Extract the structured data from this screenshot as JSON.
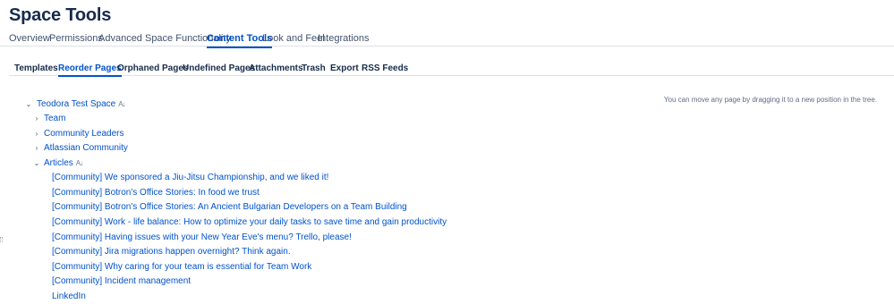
{
  "page": {
    "title": "Space Tools"
  },
  "primary_tabs": [
    {
      "label": "Overview"
    },
    {
      "label": "Permissions"
    },
    {
      "label": "Advanced Space Functionality"
    },
    {
      "label": "Content Tools"
    },
    {
      "label": "Look and Feel"
    },
    {
      "label": "Integrations"
    }
  ],
  "secondary_tabs": [
    {
      "label": "Templates"
    },
    {
      "label": "Reorder Pages"
    },
    {
      "label": "Orphaned Pages"
    },
    {
      "label": "Undefined Pages"
    },
    {
      "label": "Attachments"
    },
    {
      "label": "Trash"
    },
    {
      "label": "Export"
    },
    {
      "label": "RSS Feeds"
    }
  ],
  "hint": "You can move any page by dragging it to a new position in the tree.",
  "tree": {
    "root": {
      "label": "Teodora Test Space",
      "expanded": true
    },
    "children": [
      {
        "label": "Team",
        "expanded": false
      },
      {
        "label": "Community Leaders",
        "expanded": false
      },
      {
        "label": "Atlassian Community",
        "expanded": false
      },
      {
        "label": "Articles",
        "expanded": true
      }
    ],
    "articles": [
      "[Community] We sponsored a Jiu-Jitsu Championship, and we liked it!",
      "[Community] Botron's Office Stories: In food we trust",
      "[Community] Botron's Office Stories: An Ancient Bulgarian Developers on a Team Building",
      "[Community] Work - life balance: How to optimize your daily tasks to save time and gain productivity",
      "[Community] Having issues with your New Year Eve's menu? Trello, please!",
      "[Community] Jira migrations happen overnight? Think again.",
      "[Community] Why caring for your team is essential for Team Work",
      "[Community] Incident management",
      "LinkedIn"
    ]
  },
  "icons": {
    "expanded": "chevron-down-icon",
    "collapsed": "chevron-right-icon",
    "sort": "sort-alpha-icon"
  },
  "colors": {
    "link": "#0052cc",
    "text": "#172b4d",
    "divider": "#dfe1e6"
  }
}
